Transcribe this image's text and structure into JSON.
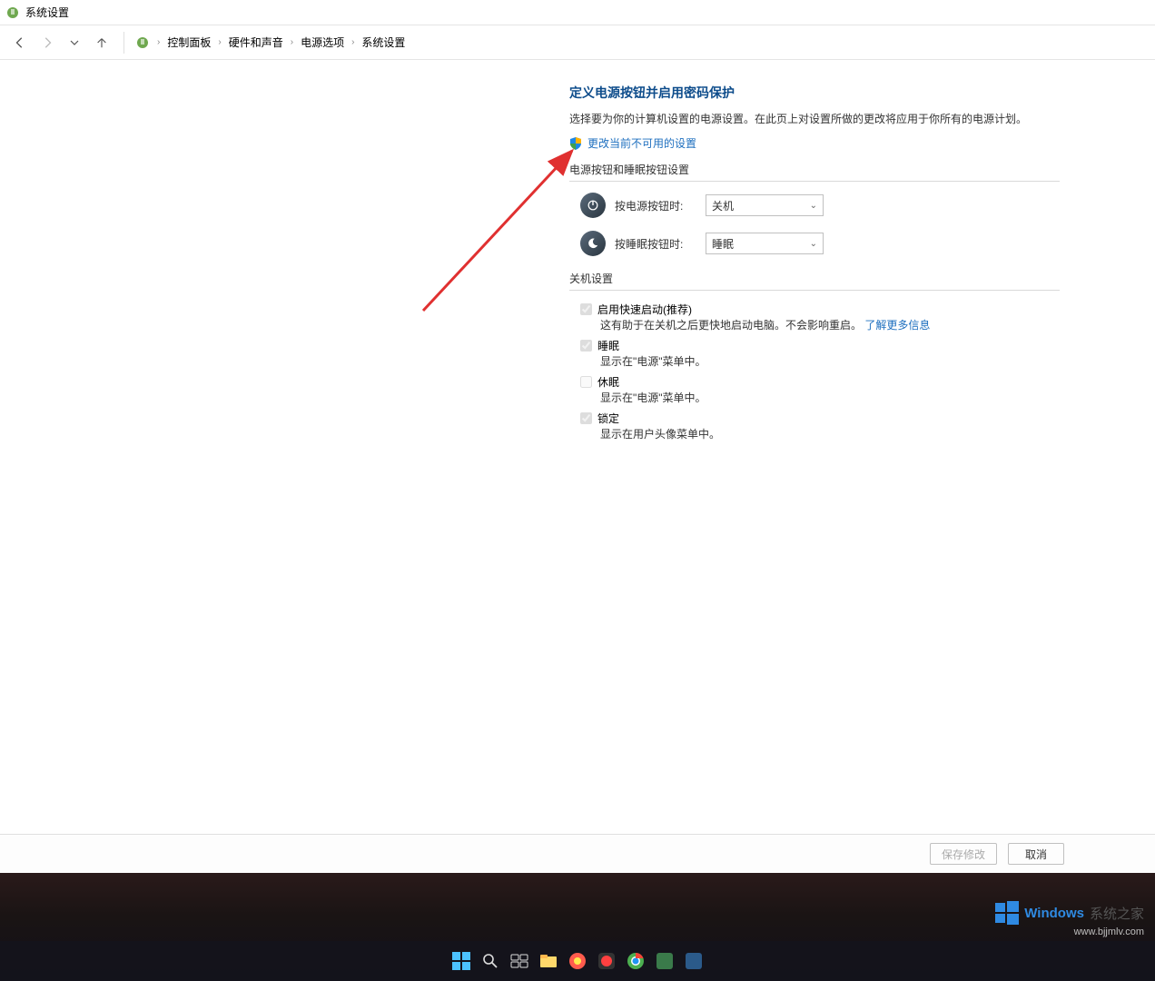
{
  "window": {
    "title": "系统设置"
  },
  "breadcrumb": {
    "items": [
      "控制面板",
      "硬件和声音",
      "电源选项",
      "系统设置"
    ]
  },
  "page": {
    "title": "定义电源按钮并启用密码保护",
    "description": "选择要为你的计算机设置的电源设置。在此页上对设置所做的更改将应用于你所有的电源计划。",
    "change_link": "更改当前不可用的设置"
  },
  "sections": {
    "buttons_header": "电源按钮和睡眠按钮设置",
    "power_button_label": "按电源按钮时:",
    "power_button_value": "关机",
    "sleep_button_label": "按睡眠按钮时:",
    "sleep_button_value": "睡眠",
    "shutdown_header": "关机设置",
    "fast_startup": {
      "label": "启用快速启动(推荐)",
      "desc_prefix": "这有助于在关机之后更快地启动电脑。不会影响重启。",
      "link": "了解更多信息"
    },
    "sleep": {
      "label": "睡眠",
      "desc": "显示在\"电源\"菜单中。"
    },
    "hibernate": {
      "label": "休眠",
      "desc": "显示在\"电源\"菜单中。"
    },
    "lock": {
      "label": "锁定",
      "desc": "显示在用户头像菜单中。"
    }
  },
  "buttons": {
    "save": "保存修改",
    "cancel": "取消"
  },
  "watermark": {
    "brand_en": "Windows",
    "brand_zh": "系统之家",
    "url": "www.bjjmlv.com"
  }
}
